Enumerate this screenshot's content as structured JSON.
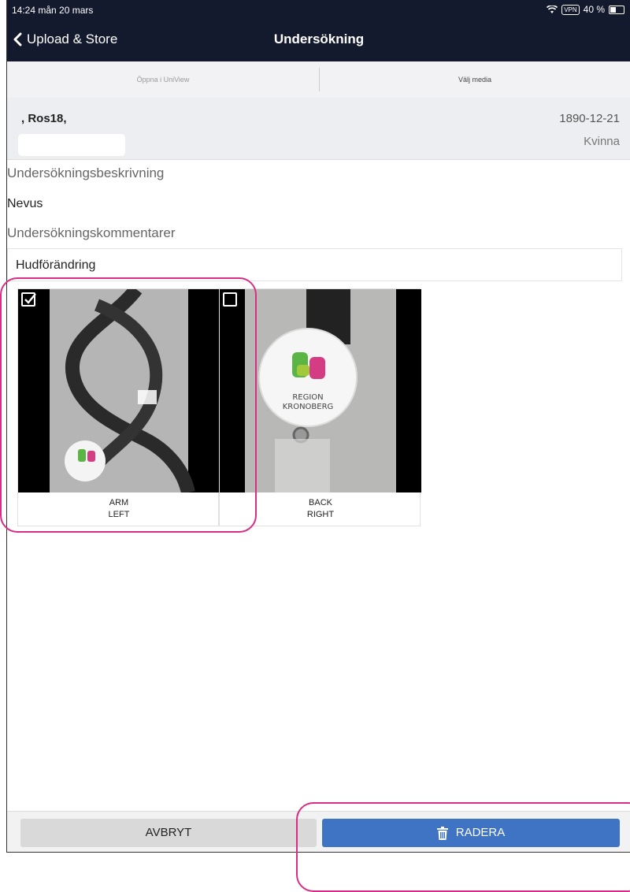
{
  "status_bar": {
    "time": "14:24  mån 20 mars",
    "vpn": "VPN",
    "battery": "40 %"
  },
  "nav": {
    "back_label": "Upload & Store",
    "title": "Undersökning"
  },
  "toolbar": {
    "open_label": "Öppna i UniView",
    "select_media_label": "Välj media"
  },
  "patient": {
    "name": ", Ros18,",
    "dob": "1890-12-21",
    "sex": "Kvinna"
  },
  "exam": {
    "description_label": "Undersökningsbeskrivning",
    "description_value": "Nevus",
    "comments_label": "Undersökningskommentarer",
    "comments_value": "Hudförändring"
  },
  "media": [
    {
      "line1": "ARM",
      "line2": "LEFT",
      "checked": true
    },
    {
      "line1": "BACK",
      "line2": "RIGHT",
      "checked": false
    }
  ],
  "footer": {
    "cancel_label": "AVBRYT",
    "delete_label": "RADERA"
  },
  "colors": {
    "nav_bg": "#141a2e",
    "primary": "#3f73c4",
    "highlight": "#d62e84"
  }
}
